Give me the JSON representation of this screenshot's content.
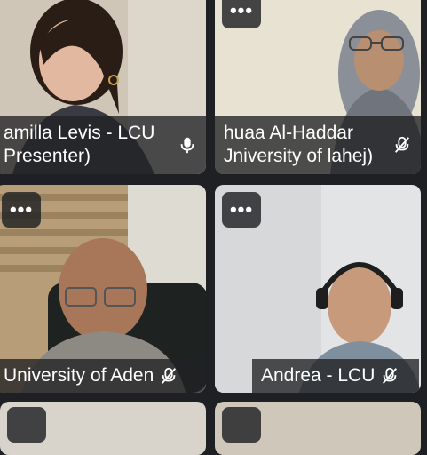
{
  "participants": [
    {
      "name_line1": "amilla Levis - LCU",
      "name_line2": "Presenter)",
      "mic": "mic-on-icon"
    },
    {
      "name_line1": "huaa Al-Haddar",
      "name_line2": "Jniversity of lahej)",
      "mic": "mic-off-icon"
    },
    {
      "name_line1": "University of Aden",
      "mic": "mic-off-icon"
    },
    {
      "name_line1": "Andrea - LCU",
      "mic": "mic-off-icon"
    }
  ],
  "more_options_glyph": "•••",
  "colors": {
    "tile_overlay": "#202124",
    "label_text": "#ffffff"
  }
}
